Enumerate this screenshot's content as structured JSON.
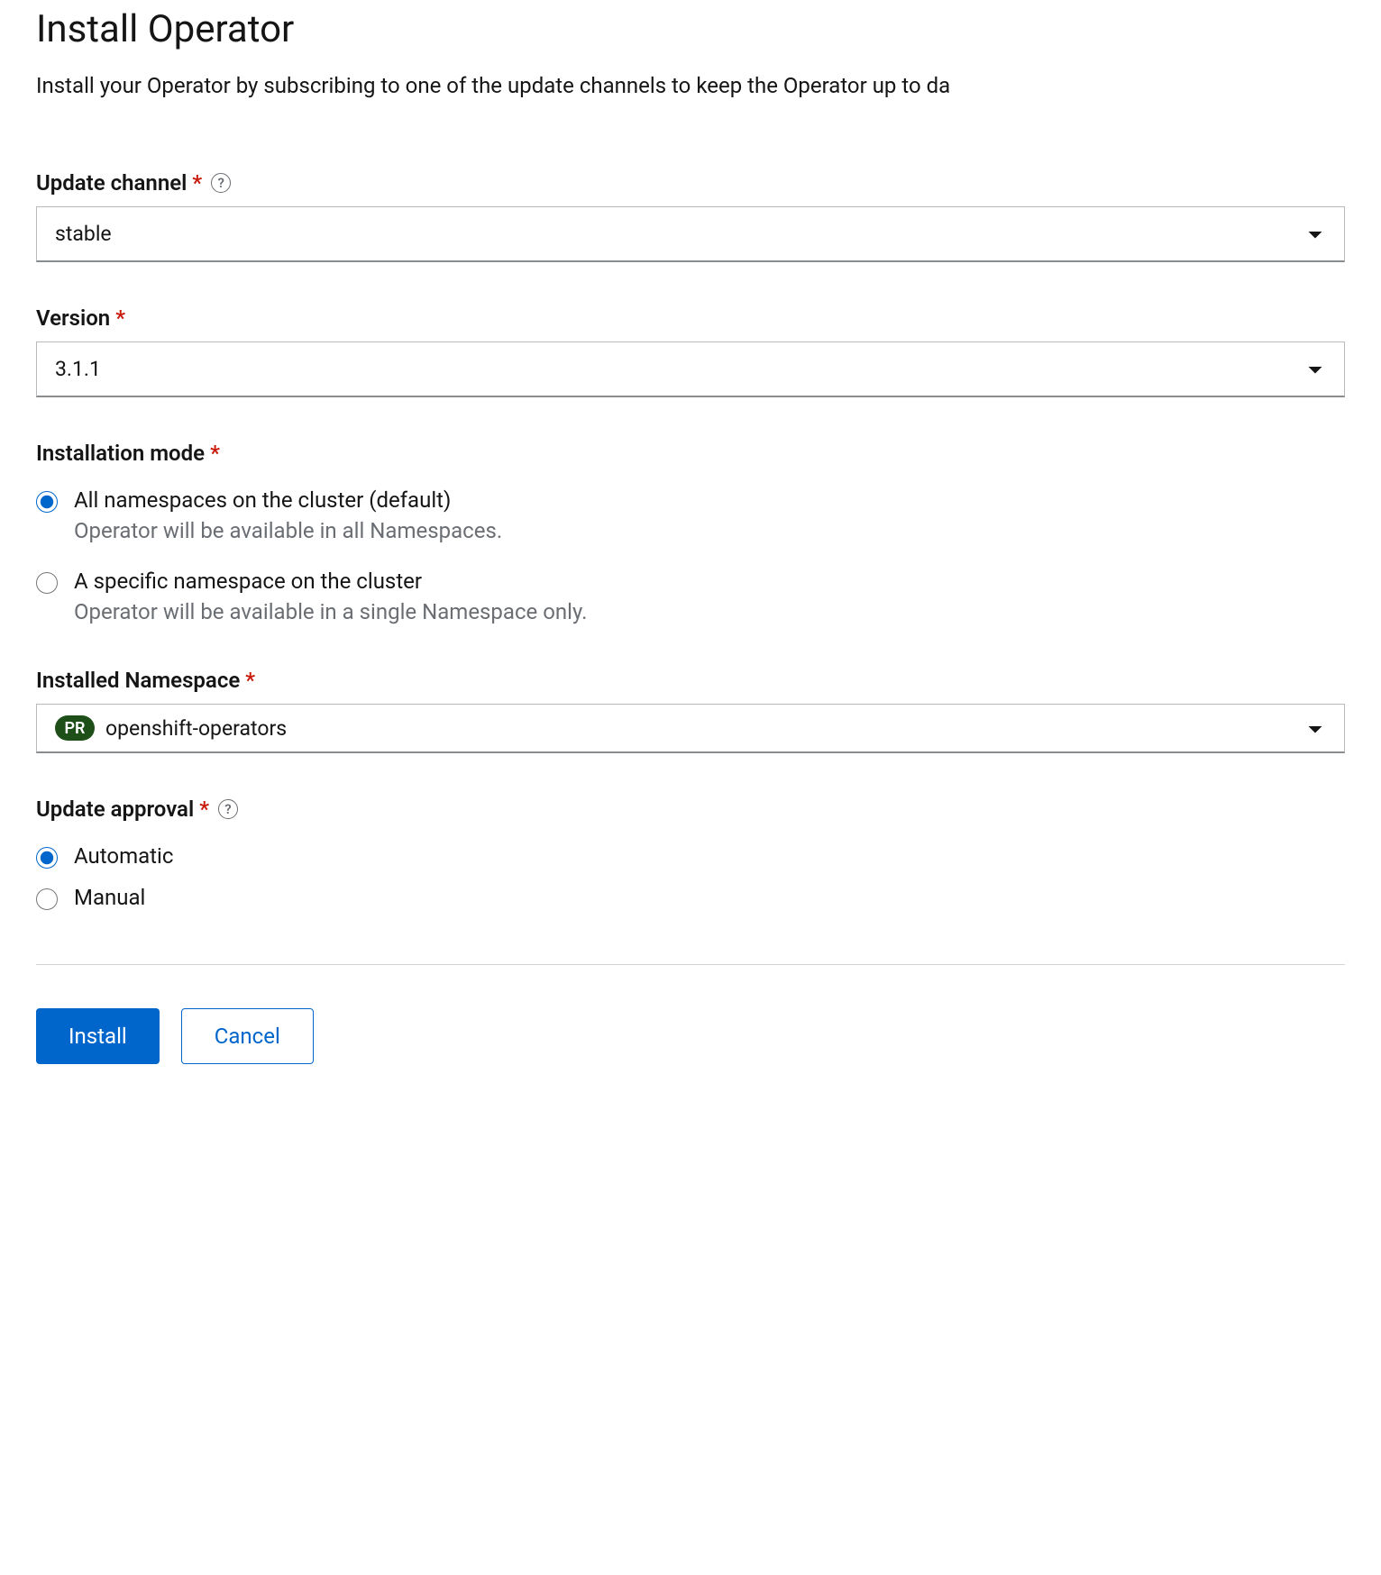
{
  "page": {
    "title": "Install Operator",
    "description": "Install your Operator by subscribing to one of the update channels to keep the Operator up to da"
  },
  "fields": {
    "updateChannel": {
      "label": "Update channel",
      "value": "stable"
    },
    "version": {
      "label": "Version",
      "value": "3.1.1"
    },
    "installationMode": {
      "label": "Installation mode",
      "options": [
        {
          "label": "All namespaces on the cluster (default)",
          "description": "Operator will be available in all Namespaces.",
          "checked": true
        },
        {
          "label": "A specific namespace on the cluster",
          "description": "Operator will be available in a single Namespace only.",
          "checked": false
        }
      ]
    },
    "installedNamespace": {
      "label": "Installed Namespace",
      "badge": "PR",
      "value": "openshift-operators"
    },
    "updateApproval": {
      "label": "Update approval",
      "options": [
        {
          "label": "Automatic",
          "checked": true
        },
        {
          "label": "Manual",
          "checked": false
        }
      ]
    }
  },
  "buttons": {
    "install": "Install",
    "cancel": "Cancel"
  }
}
